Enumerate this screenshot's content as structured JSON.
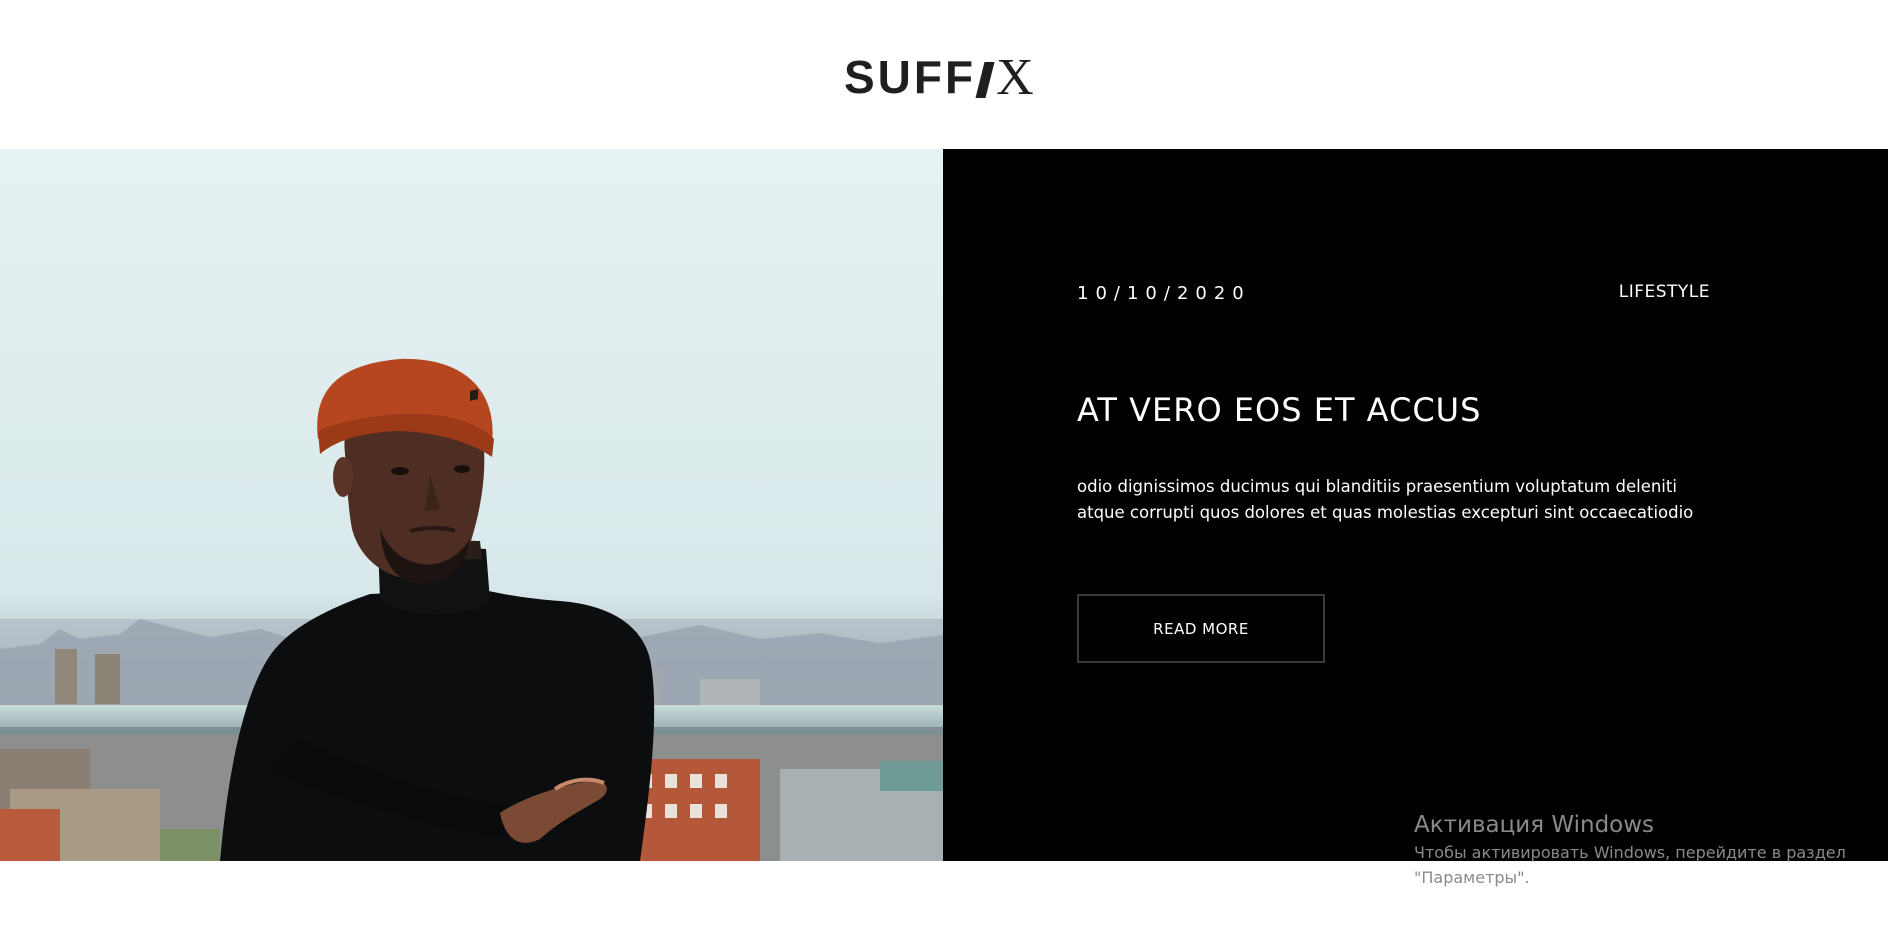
{
  "header": {
    "logo": {
      "main": "SUFF",
      "accent": "X"
    }
  },
  "hero": {
    "image": {
      "subject": "man-in-red-beanie-photo"
    },
    "post": {
      "date": "10/10/2020",
      "category": "LIFESTYLE",
      "title": "AT VERO EOS ET ACCUS",
      "excerpt": "odio dignissimos ducimus qui blanditiis praesentium voluptatum deleniti atque corrupti quos dolores et quas molestias excepturi sint occaecatiodio",
      "read_more_label": "READ MORE"
    }
  },
  "watermark": {
    "title": "Активация Windows",
    "text": "Чтобы активировать Windows, перейдите в раздел \"Параметры\"."
  },
  "colors": {
    "panel_bg": "#000000",
    "page_bg": "#ffffff",
    "logo": "#1f1f1f",
    "beanie": "#b54620",
    "watermark": "#8a8a8a"
  }
}
